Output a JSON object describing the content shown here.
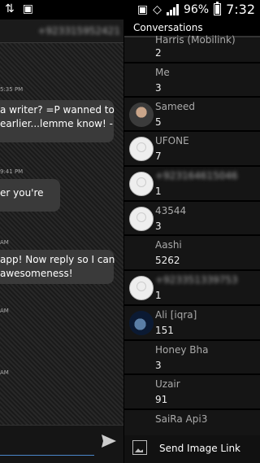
{
  "status_bar": {
    "battery": "96%",
    "time": "7:32",
    "icons": [
      "usb-icon",
      "download-icon",
      "vibrate-icon",
      "wifi-icon",
      "signal-icon",
      "battery-icon"
    ]
  },
  "thread": {
    "contact_number": "+923315952421",
    "messages": [
      {
        "time": "5:35 PM",
        "lines": [
          "a writer? =P wanned to",
          "earlier...lemme know! -"
        ]
      },
      {
        "time": "9:41 PM",
        "lines": [
          "er you're"
        ]
      },
      {
        "time": "AM",
        "lines": [
          "app! Now reply so I can",
          "awesomeness!"
        ]
      },
      {
        "time": "AM"
      },
      {
        "time": "AM"
      }
    ]
  },
  "conversations": {
    "title": "Conversations",
    "items": [
      {
        "name": "Harris (Mobilink)",
        "count": "2",
        "avatar": "none"
      },
      {
        "name": "Me",
        "count": "3",
        "avatar": "none"
      },
      {
        "name": "Sameed",
        "count": "5",
        "avatar": "photo"
      },
      {
        "name": "UFONE",
        "count": "7",
        "avatar": "blank"
      },
      {
        "name": "+923164615046",
        "count": "1",
        "avatar": "blank"
      },
      {
        "name": "43544",
        "count": "3",
        "avatar": "blank"
      },
      {
        "name": "Aashi",
        "count": "5262",
        "avatar": "none"
      },
      {
        "name": "+923351339753",
        "count": "1",
        "avatar": "blank"
      },
      {
        "name": "Ali [iqra]",
        "count": "151",
        "avatar": "photo"
      },
      {
        "name": "Honey Bha",
        "count": "3",
        "avatar": "none"
      },
      {
        "name": "Uzair",
        "count": "91",
        "avatar": "none"
      },
      {
        "name": "SaiRa Api3",
        "count": "",
        "avatar": "none"
      }
    ],
    "footer_label": "Send Image Link"
  }
}
